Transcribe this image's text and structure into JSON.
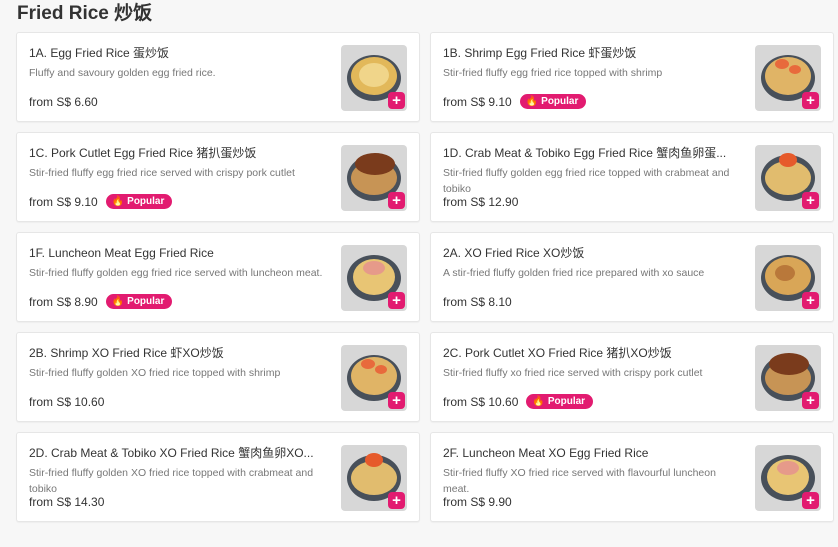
{
  "section": {
    "title": "Fried Rice 炒饭"
  },
  "badge_label": "Popular",
  "accent_color": "#e21b70",
  "items": [
    {
      "name": "1A. Egg Fried Rice 蛋炒饭",
      "desc": "Fluffy and savoury golden egg fried rice.",
      "price": "from S$ 6.60",
      "popular": false,
      "food": "egg"
    },
    {
      "name": "1B. Shrimp Egg Fried Rice 虾蛋炒饭",
      "desc": "Stir-fried fluffy egg fried rice topped with shrimp",
      "price": "from S$ 9.10",
      "popular": true,
      "food": "shrimp"
    },
    {
      "name": "1C. Pork Cutlet Egg Fried Rice 猪扒蛋炒饭",
      "desc": "Stir-fried fluffy egg fried rice served with crispy pork cutlet",
      "price": "from S$ 9.10",
      "popular": true,
      "food": "pork"
    },
    {
      "name": "1D. Crab Meat & Tobiko Egg Fried Rice 蟹肉鱼卵蛋...",
      "desc": "Stir-fried fluffy golden egg fried rice topped with crabmeat and tobiko",
      "price": "from S$ 12.90",
      "popular": false,
      "food": "crab"
    },
    {
      "name": "1F. Luncheon Meat Egg Fried Rice",
      "desc": "Stir-fried fluffy golden egg fried rice served with luncheon meat.",
      "price": "from S$ 8.90",
      "popular": true,
      "food": "luncheon"
    },
    {
      "name": "2A. XO Fried Rice XO炒饭",
      "desc": "A stir-fried fluffy golden fried rice prepared with xo sauce",
      "price": "from S$ 8.10",
      "popular": false,
      "food": "xo"
    },
    {
      "name": "2B. Shrimp XO Fried Rice 虾XO炒饭",
      "desc": "Stir-fried fluffy golden XO fried rice topped with shrimp",
      "price": "from S$ 10.60",
      "popular": false,
      "food": "shrimp"
    },
    {
      "name": "2C. Pork Cutlet XO Fried Rice 猪扒XO炒饭",
      "desc": "Stir-fried fluffy xo fried rice served with crispy pork cutlet",
      "price": "from S$ 10.60",
      "popular": true,
      "food": "pork"
    },
    {
      "name": "2D. Crab Meat & Tobiko XO Fried Rice 蟹肉鱼卵XO...",
      "desc": "Stir-fried fluffy golden XO fried rice topped with crabmeat and tobiko",
      "price": "from S$ 14.30",
      "popular": false,
      "food": "crab"
    },
    {
      "name": "2F. Luncheon Meat XO Egg Fried Rice",
      "desc": "Stir-fried fluffy XO fried rice served with flavourful luncheon meat.",
      "price": "from S$ 9.90",
      "popular": false,
      "food": "luncheon"
    }
  ]
}
